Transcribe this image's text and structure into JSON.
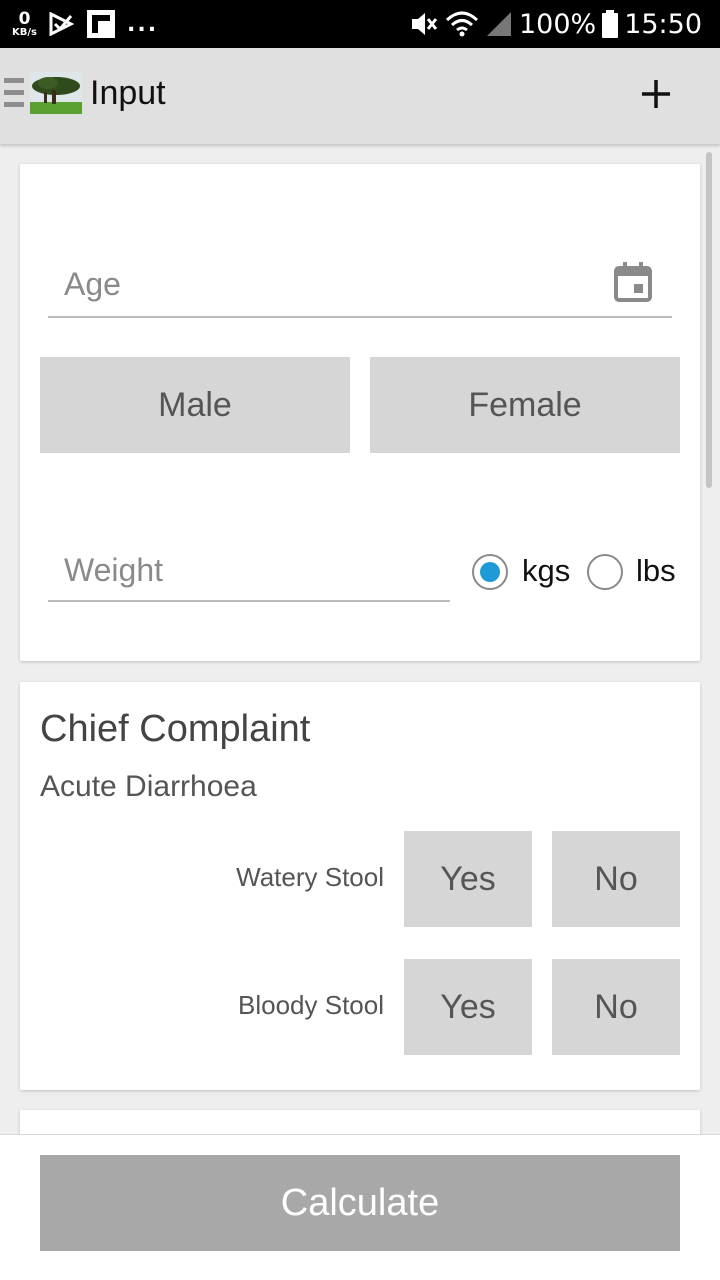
{
  "status_bar": {
    "data_rate_value": "0",
    "data_rate_unit": "KB/s",
    "more_indicator": "...",
    "battery": "100%",
    "time": "15:50"
  },
  "app_bar": {
    "title": "Input",
    "icons": [
      "menu-icon",
      "tree-logo",
      "add-icon"
    ]
  },
  "demographics": {
    "age_placeholder": "Age",
    "male_label": "Male",
    "female_label": "Female",
    "weight_placeholder": "Weight",
    "unit_kgs": "kgs",
    "unit_lbs": "lbs",
    "selected_unit": "kgs"
  },
  "chief_complaint": {
    "title": "Chief Complaint",
    "subtitle": "Acute Diarrhoea",
    "questions": [
      {
        "label": "Watery Stool",
        "yes": "Yes",
        "no": "No"
      },
      {
        "label": "Bloody Stool",
        "yes": "Yes",
        "no": "No"
      }
    ]
  },
  "footer": {
    "calculate_label": "Calculate"
  },
  "colors": {
    "radio_accent": "#1e9bd7",
    "button_bg": "#d6d6d6",
    "calculate_bg": "#a8a8a8",
    "app_bar_bg": "#e0e0e0"
  }
}
